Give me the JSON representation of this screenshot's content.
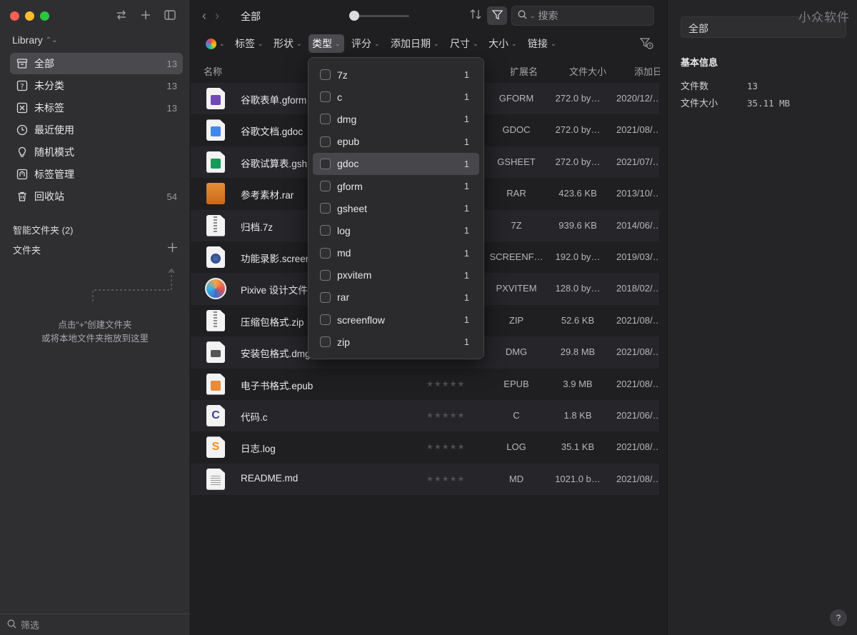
{
  "sidebar": {
    "library_label": "Library",
    "items": [
      {
        "label": "全部",
        "count": "13",
        "icon": "archive-icon"
      },
      {
        "label": "未分类",
        "count": "13",
        "icon": "question-icon"
      },
      {
        "label": "未标签",
        "count": "13",
        "icon": "untagged-icon"
      },
      {
        "label": "最近使用",
        "count": "",
        "icon": "clock-icon"
      },
      {
        "label": "随机模式",
        "count": "",
        "icon": "lightbulb-icon"
      },
      {
        "label": "标签管理",
        "count": "",
        "icon": "tag-manage-icon"
      },
      {
        "label": "回收站",
        "count": "54",
        "icon": "trash-icon"
      }
    ],
    "smart_folders": "智能文件夹 (2)",
    "folders": "文件夹",
    "hint_line1": "点击“+”创建文件夹",
    "hint_line2": "或将本地文件夹拖放到这里",
    "filter_placeholder": "筛选"
  },
  "toolbar": {
    "breadcrumb": "全部",
    "search_placeholder": "搜索"
  },
  "filterbar": {
    "chips": [
      "标签",
      "形状",
      "类型",
      "评分",
      "添加日期",
      "尺寸",
      "大小",
      "链接"
    ],
    "active": "类型"
  },
  "columns": {
    "name": "名称",
    "ext": "扩展名",
    "size": "文件大小",
    "date": "添加日期"
  },
  "files": [
    {
      "name": "谷歌表单.gform",
      "ext": "GFORM",
      "size": "272.0 by…",
      "date": "2020/12/…"
    },
    {
      "name": "谷歌文档.gdoc",
      "ext": "GDOC",
      "size": "272.0 by…",
      "date": "2021/08/…"
    },
    {
      "name": "谷歌试算表.gsh",
      "ext": "GSHEET",
      "size": "272.0 by…",
      "date": "2021/07/…"
    },
    {
      "name": "参考素材.rar",
      "ext": "RAR",
      "size": "423.6 KB",
      "date": "2013/10/…"
    },
    {
      "name": "归档.7z",
      "ext": "7Z",
      "size": "939.6 KB",
      "date": "2014/06/…"
    },
    {
      "name": "功能录影.screen",
      "ext": "SCREENF…",
      "size": "192.0 by…",
      "date": "2019/03/…"
    },
    {
      "name": "Pixive 设计文件",
      "ext": "PXVITEM",
      "size": "128.0 by…",
      "date": "2018/02/…"
    },
    {
      "name": "压缩包格式.zip",
      "ext": "ZIP",
      "size": "52.6 KB",
      "date": "2021/08/…"
    },
    {
      "name": "安装包格式.dmg",
      "ext": "DMG",
      "size": "29.8 MB",
      "date": "2021/08/…"
    },
    {
      "name": "电子书格式.epub",
      "ext": "EPUB",
      "size": "3.9 MB",
      "date": "2021/08/…"
    },
    {
      "name": "代码.c",
      "ext": "C",
      "size": "1.8 KB",
      "date": "2021/06/…"
    },
    {
      "name": "日志.log",
      "ext": "LOG",
      "size": "35.1 KB",
      "date": "2021/08/…"
    },
    {
      "name": "README.md",
      "ext": "MD",
      "size": "1021.0 b…",
      "date": "2021/08/…"
    }
  ],
  "type_dropdown": [
    {
      "label": "7z",
      "count": "1"
    },
    {
      "label": "c",
      "count": "1"
    },
    {
      "label": "dmg",
      "count": "1"
    },
    {
      "label": "epub",
      "count": "1"
    },
    {
      "label": "gdoc",
      "count": "1"
    },
    {
      "label": "gform",
      "count": "1"
    },
    {
      "label": "gsheet",
      "count": "1"
    },
    {
      "label": "log",
      "count": "1"
    },
    {
      "label": "md",
      "count": "1"
    },
    {
      "label": "pxvitem",
      "count": "1"
    },
    {
      "label": "rar",
      "count": "1"
    },
    {
      "label": "screenflow",
      "count": "1"
    },
    {
      "label": "zip",
      "count": "1"
    }
  ],
  "inspector": {
    "title": "全部",
    "watermark": "小众软件",
    "section": "基本信息",
    "file_count_label": "文件数",
    "file_count": "13",
    "file_size_label": "文件大小",
    "file_size": "35.11 MB",
    "help": "?"
  },
  "colors": {
    "close": "#fe5f57",
    "minimize": "#febc2e",
    "maximize": "#28c840",
    "active_bg": "#4a4a4e"
  }
}
